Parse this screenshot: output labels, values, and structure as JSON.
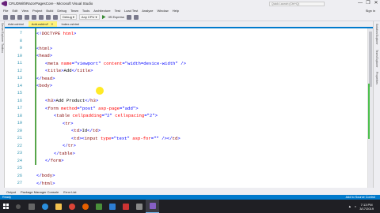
{
  "window": {
    "title": "CRUDWithRazorPagesCore - Microsoft Visual Studio",
    "quick_launch": "Quick Launch (Ctrl+Q)",
    "controls": [
      "—",
      "❐",
      "✕"
    ]
  },
  "menu": {
    "items": [
      "File",
      "Edit",
      "View",
      "Project",
      "Build",
      "Debug",
      "Team",
      "Tools",
      "Architecture",
      "Test",
      "Load Test",
      "Analyze",
      "Window",
      "Help"
    ],
    "user": "Sign in"
  },
  "toolbar": {
    "config": "Debug",
    "platform": "Any CPU",
    "run_label": "IIS Express"
  },
  "side_tabs_left": [
    "Server Explorer",
    "Toolbox"
  ],
  "side_tabs_right": [
    "Solution Explorer",
    "Team Explorer",
    "Properties"
  ],
  "tabs": [
    {
      "label": "Add.cshtml",
      "active": false
    },
    {
      "label": "Add.cshtml*",
      "active": true
    },
    {
      "label": "Index.cshtml",
      "active": false
    }
  ],
  "code": [
    {
      "n": "7",
      "indent": 0,
      "parts": [
        [
          "br",
          "<!"
        ],
        [
          "tag",
          "DOCTYPE"
        ],
        [
          "attr",
          " html"
        ],
        [
          "br",
          ">"
        ]
      ]
    },
    {
      "n": "8",
      "indent": 0,
      "parts": []
    },
    {
      "n": "9",
      "indent": 0,
      "parts": [
        [
          "br",
          "<"
        ],
        [
          "tag",
          "html"
        ],
        [
          "br",
          ">"
        ]
      ]
    },
    {
      "n": "10",
      "indent": 0,
      "parts": [
        [
          "br",
          "<"
        ],
        [
          "tag",
          "head"
        ],
        [
          "br",
          ">"
        ]
      ]
    },
    {
      "n": "11",
      "indent": 1,
      "parts": [
        [
          "br",
          "<"
        ],
        [
          "tag",
          "meta"
        ],
        [
          "attr",
          " name"
        ],
        [
          "br",
          "="
        ],
        [
          "str",
          "\"viewport\""
        ],
        [
          "attr",
          " content"
        ],
        [
          "br",
          "="
        ],
        [
          "str",
          "\"width=device-width\""
        ],
        [
          "br",
          " />"
        ]
      ]
    },
    {
      "n": "12",
      "indent": 1,
      "parts": [
        [
          "br",
          "<"
        ],
        [
          "tag",
          "title"
        ],
        [
          "br",
          ">"
        ],
        [
          "txt",
          "Add"
        ],
        [
          "br",
          "</"
        ],
        [
          "tag",
          "title"
        ],
        [
          "br",
          ">"
        ]
      ]
    },
    {
      "n": "13",
      "indent": 0,
      "parts": [
        [
          "br",
          "</"
        ],
        [
          "tag",
          "head"
        ],
        [
          "br",
          ">"
        ]
      ]
    },
    {
      "n": "14",
      "indent": 0,
      "parts": [
        [
          "br",
          "<"
        ],
        [
          "tag",
          "body"
        ],
        [
          "br",
          ">"
        ]
      ]
    },
    {
      "n": "15",
      "indent": 0,
      "parts": []
    },
    {
      "n": "16",
      "indent": 1,
      "parts": [
        [
          "br",
          "<"
        ],
        [
          "tag",
          "h3"
        ],
        [
          "br",
          ">"
        ],
        [
          "txt",
          "Add Product"
        ],
        [
          "br",
          "</"
        ],
        [
          "tag",
          "h3"
        ],
        [
          "br",
          ">"
        ]
      ]
    },
    {
      "n": "17",
      "indent": 1,
      "parts": [
        [
          "br",
          "<"
        ],
        [
          "tag",
          "form"
        ],
        [
          "attr",
          " method"
        ],
        [
          "br",
          "="
        ],
        [
          "str",
          "\"post\""
        ],
        [
          "attr",
          " asp-page"
        ],
        [
          "br",
          "="
        ],
        [
          "str",
          "\"add\""
        ],
        [
          "br",
          ">"
        ]
      ]
    },
    {
      "n": "18",
      "indent": 2,
      "parts": [
        [
          "br",
          "<"
        ],
        [
          "tag",
          "table"
        ],
        [
          "attr",
          " cellpadding"
        ],
        [
          "br",
          "="
        ],
        [
          "str",
          "\"2\""
        ],
        [
          "attr",
          " cellspacing"
        ],
        [
          "br",
          "="
        ],
        [
          "str",
          "\"2\""
        ],
        [
          "br",
          ">"
        ]
      ]
    },
    {
      "n": "19",
      "indent": 3,
      "parts": [
        [
          "br",
          "<"
        ],
        [
          "tag",
          "tr"
        ],
        [
          "br",
          ">"
        ]
      ]
    },
    {
      "n": "20",
      "indent": 4,
      "parts": [
        [
          "br",
          "<"
        ],
        [
          "tag",
          "td"
        ],
        [
          "br",
          ">"
        ],
        [
          "txt",
          "Id"
        ],
        [
          "br",
          "</"
        ],
        [
          "tag",
          "td"
        ],
        [
          "br",
          ">"
        ]
      ]
    },
    {
      "n": "21",
      "indent": 4,
      "parts": [
        [
          "br",
          "<"
        ],
        [
          "tag",
          "td"
        ],
        [
          "br",
          "><"
        ],
        [
          "tag",
          "input"
        ],
        [
          "attr",
          " type"
        ],
        [
          "br",
          "="
        ],
        [
          "str",
          "\"text\""
        ],
        [
          "attr",
          " asp-for"
        ],
        [
          "br",
          "="
        ],
        [
          "str",
          "\"\""
        ],
        [
          "br",
          " /></"
        ],
        [
          "tag",
          "td"
        ],
        [
          "br",
          ">"
        ]
      ]
    },
    {
      "n": "22",
      "indent": 3,
      "parts": [
        [
          "br",
          "</"
        ],
        [
          "tag",
          "tr"
        ],
        [
          "br",
          ">"
        ]
      ]
    },
    {
      "n": "23",
      "indent": 2,
      "parts": [
        [
          "br",
          "</"
        ],
        [
          "tag",
          "table"
        ],
        [
          "br",
          ">"
        ]
      ]
    },
    {
      "n": "24",
      "indent": 1,
      "parts": [
        [
          "br",
          "</"
        ],
        [
          "tag",
          "form"
        ],
        [
          "br",
          ">"
        ]
      ]
    },
    {
      "n": "25",
      "indent": 0,
      "parts": []
    },
    {
      "n": "26",
      "indent": 0,
      "parts": [
        [
          "br",
          "</"
        ],
        [
          "tag",
          "body"
        ],
        [
          "br",
          ">"
        ]
      ]
    },
    {
      "n": "27",
      "indent": 0,
      "parts": [
        [
          "br",
          "</"
        ],
        [
          "tag",
          "html"
        ],
        [
          "br",
          ">"
        ]
      ]
    }
  ],
  "output_tabs": [
    "Output",
    "Package Manager Console",
    "Error List"
  ],
  "status": {
    "left": "Ready",
    "right": "Add to Source Control"
  },
  "taskbar": {
    "time": "7:13 PM",
    "date": "3/17/2019"
  }
}
